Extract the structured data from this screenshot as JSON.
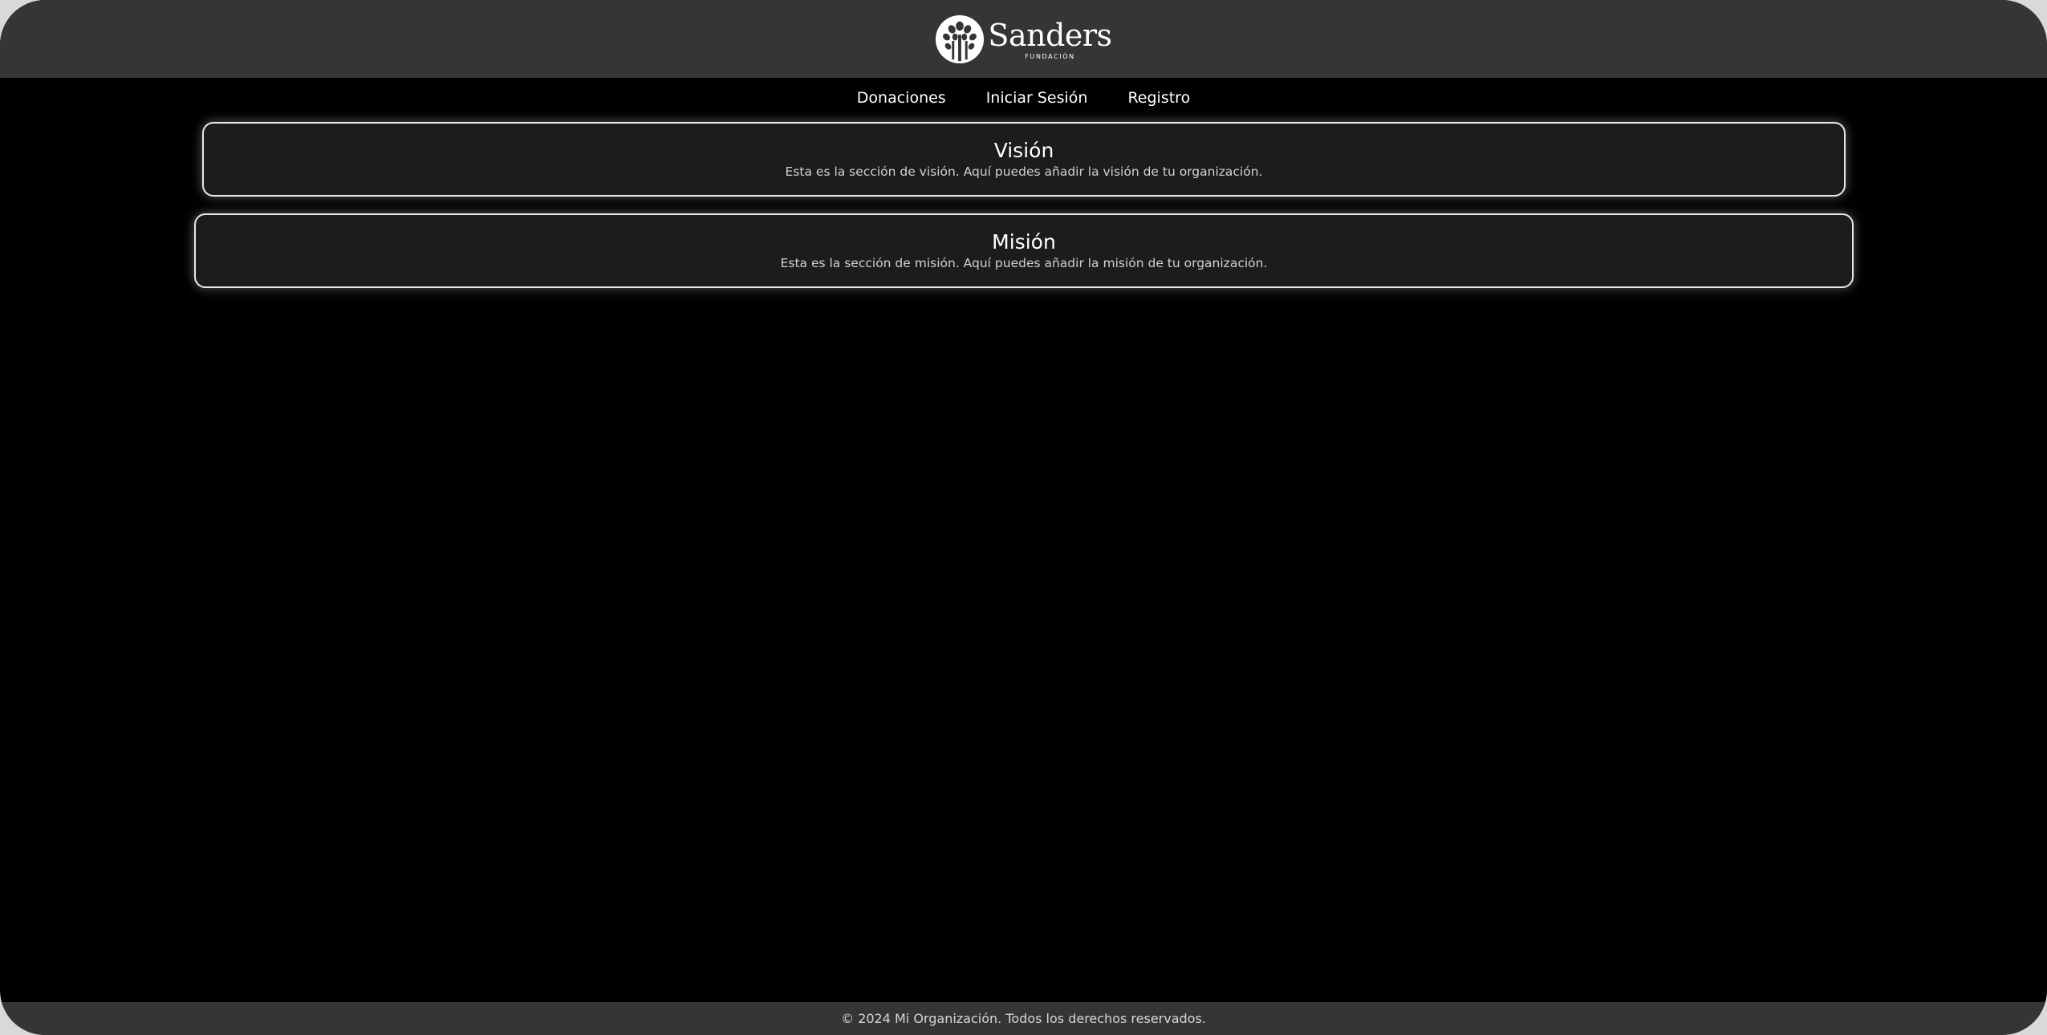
{
  "header": {
    "brand_name": "Sanders",
    "brand_subtitle": "FUNDACIÓN",
    "logo_icon": "tree-icon"
  },
  "nav": {
    "items": [
      {
        "label": "Donaciones"
      },
      {
        "label": "Iniciar Sesión"
      },
      {
        "label": "Registro"
      }
    ]
  },
  "sections": {
    "vision": {
      "title": "Visión",
      "text": "Esta es la sección de visión. Aquí puedes añadir la visión de tu organización."
    },
    "mision": {
      "title": "Misión",
      "text": "Esta es la sección de misión. Aquí puedes añadir la misión de tu organización."
    }
  },
  "footer": {
    "text": "© 2024 Mi Organización. Todos los derechos reservados."
  },
  "colors": {
    "page_background": "#000000",
    "header_footer": "#353535",
    "card_background": "#1c1c1c",
    "card_border": "#e8e8e8",
    "text": "#ffffff"
  }
}
